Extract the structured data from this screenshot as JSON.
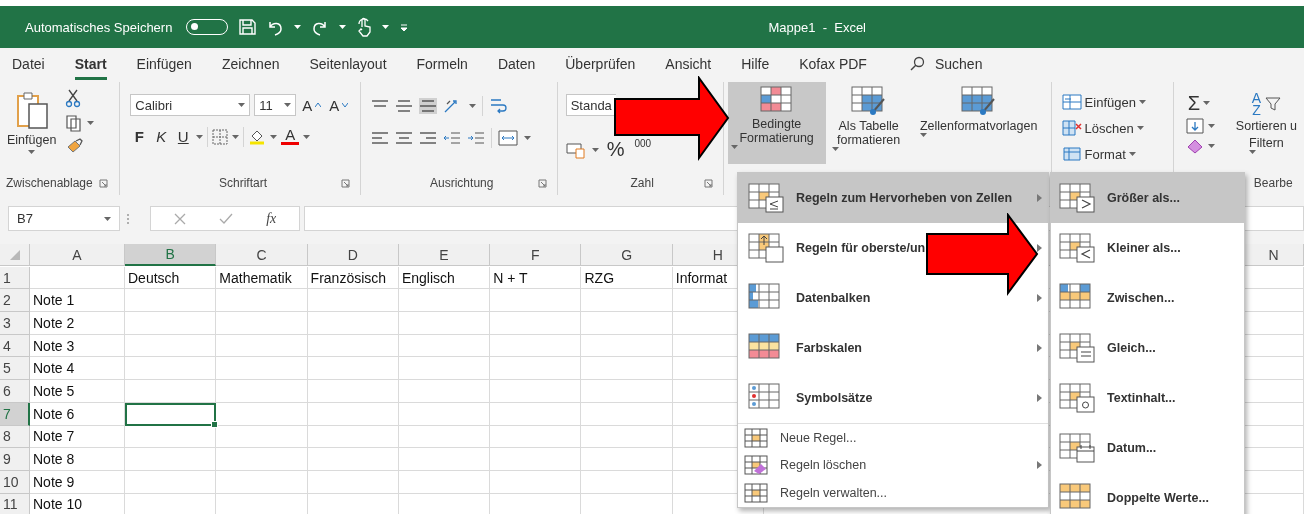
{
  "title_bar": {
    "autosave_label": "Automatisches Speichern",
    "autosave_on": false,
    "title": "Mappe1  -  Excel"
  },
  "tabs": [
    {
      "label": "Datei",
      "selected": false
    },
    {
      "label": "Start",
      "selected": true
    },
    {
      "label": "Einfügen",
      "selected": false
    },
    {
      "label": "Zeichnen",
      "selected": false
    },
    {
      "label": "Seitenlayout",
      "selected": false
    },
    {
      "label": "Formeln",
      "selected": false
    },
    {
      "label": "Daten",
      "selected": false
    },
    {
      "label": "Überprüfen",
      "selected": false
    },
    {
      "label": "Ansicht",
      "selected": false
    },
    {
      "label": "Hilfe",
      "selected": false
    },
    {
      "label": "Kofax PDF",
      "selected": false
    }
  ],
  "search": {
    "label": "Suchen"
  },
  "ribbon": [
    {
      "kind": "clipboard",
      "label": "Zwischenablage",
      "paste": "Einfügen"
    },
    {
      "kind": "font",
      "label": "Schriftart",
      "font": "Calibri",
      "size": "11",
      "grow": "A",
      "shrink": "A",
      "bold": "F",
      "italic": "K",
      "underline": "U",
      "font_color": "A"
    },
    {
      "kind": "alignment",
      "label": "Ausrichtung"
    },
    {
      "kind": "number",
      "label": "Zahl",
      "format": "Standa",
      "percent": "%",
      "thousands": "000"
    },
    {
      "kind": "styles",
      "buttons": [
        {
          "label": "Bedingte Formatierung",
          "selected": true
        },
        {
          "label": "Als Tabelle formatieren",
          "selected": false
        },
        {
          "label": "Zellenformatvorlagen",
          "selected": false
        }
      ]
    },
    {
      "kind": "cells",
      "buttons": [
        "Einfügen",
        "Löschen",
        "Format"
      ]
    },
    {
      "kind": "editing",
      "label": "Bearbe",
      "autosum": "Σ",
      "sort_letters": [
        "A",
        "Z"
      ],
      "sort_line1": "Sortieren u",
      "sort_line2": "Filtern"
    }
  ],
  "formula_bar": {
    "name_box": "B7",
    "function_label": "fx"
  },
  "sheet": {
    "columns": [
      {
        "label": "A",
        "selected": false
      },
      {
        "label": "B",
        "selected": true
      },
      {
        "label": "C",
        "selected": false
      },
      {
        "label": "D",
        "selected": false
      },
      {
        "label": "E",
        "selected": false
      },
      {
        "label": "F",
        "selected": false
      },
      {
        "label": "G",
        "selected": false
      },
      {
        "label": "H",
        "selected": false
      },
      {
        "label": "N",
        "selected": false
      }
    ],
    "rows": [
      {
        "number": "1",
        "selected": false,
        "cells": [
          null,
          "Deutsch",
          "Mathematik",
          "Französisch",
          "Englisch",
          "N + T",
          "RZG",
          "Informat"
        ]
      },
      {
        "number": "2",
        "selected": false,
        "cells": [
          "Note 1"
        ]
      },
      {
        "number": "3",
        "selected": false,
        "cells": [
          "Note 2"
        ]
      },
      {
        "number": "4",
        "selected": false,
        "cells": [
          "Note 3"
        ]
      },
      {
        "number": "5",
        "selected": false,
        "cells": [
          "Note 4"
        ]
      },
      {
        "number": "6",
        "selected": false,
        "cells": [
          "Note 5"
        ]
      },
      {
        "number": "7",
        "selected": true,
        "cells": [
          "Note 6"
        ]
      },
      {
        "number": "8",
        "selected": false,
        "cells": [
          "Note 7"
        ]
      },
      {
        "number": "9",
        "selected": false,
        "cells": [
          "Note 8"
        ]
      },
      {
        "number": "10",
        "selected": false,
        "cells": [
          "Note 9"
        ]
      },
      {
        "number": "11",
        "selected": false,
        "cells": [
          "Note 10"
        ]
      }
    ]
  },
  "menu": {
    "items": [
      {
        "kind": "large",
        "label": "Regeln zum Hervorheben von Zellen",
        "submenu": true,
        "selected": true
      },
      {
        "kind": "large",
        "label": "Regeln für oberste/un",
        "submenu": true,
        "selected": false
      },
      {
        "kind": "large",
        "label": "Datenbalken",
        "submenu": true,
        "selected": false
      },
      {
        "kind": "large",
        "label": "Farbskalen",
        "submenu": true,
        "selected": false
      },
      {
        "kind": "large",
        "label": "Symbolsätze",
        "submenu": true,
        "selected": false
      },
      {
        "kind": "small",
        "label": "Neue Regel...",
        "submenu": false,
        "selected": false
      },
      {
        "kind": "small",
        "label": "Regeln löschen",
        "submenu": true,
        "selected": false
      },
      {
        "kind": "small",
        "label": "Regeln verwalten...",
        "submenu": false,
        "selected": false
      }
    ]
  },
  "submenu": {
    "items": [
      {
        "label": "Größer als...",
        "selected": true
      },
      {
        "label": "Kleiner als...",
        "selected": false
      },
      {
        "label": "Zwischen...",
        "selected": false
      },
      {
        "label": "Gleich...",
        "selected": false
      },
      {
        "label": "Textinhalt...",
        "selected": false
      },
      {
        "label": "Datum...",
        "selected": false
      },
      {
        "label": "Doppelte Werte...",
        "selected": false
      }
    ]
  },
  "overlays": [
    {
      "kind": "arrow"
    },
    {
      "kind": "arrow"
    }
  ]
}
